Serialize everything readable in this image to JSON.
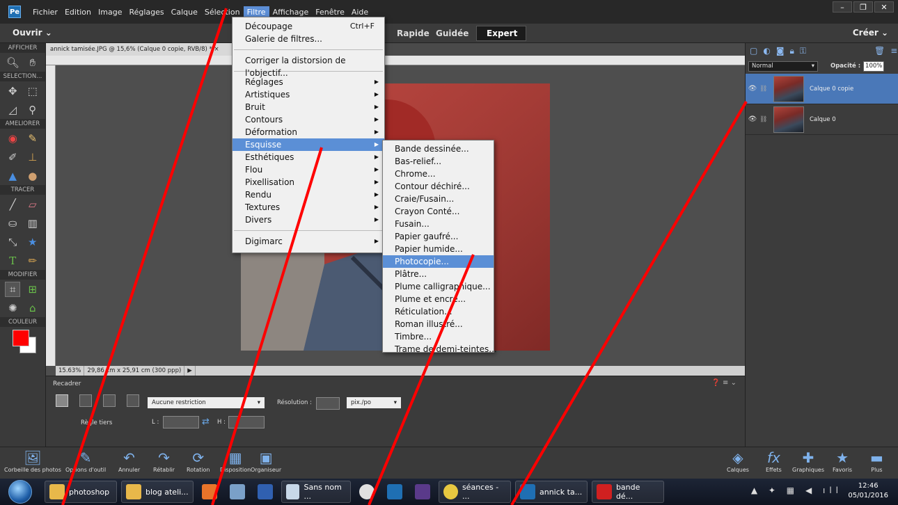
{
  "menubar": {
    "items": [
      "Fichier",
      "Edition",
      "Image",
      "Réglages",
      "Calque",
      "Sélection",
      "Filtre",
      "Affichage",
      "Fenêtre",
      "Aide"
    ],
    "active": "Filtre"
  },
  "modebar": {
    "open_label": "Ouvrir",
    "tabs": [
      "Rapide",
      "Guidée",
      "Expert"
    ],
    "active_tab": "Expert",
    "create_label": "Créer"
  },
  "toolbox": {
    "sections": [
      "AFFICHER",
      "SELECTION...",
      "AMELIORER",
      "TRACER",
      "MODIFIER",
      "COULEUR"
    ],
    "foreground_color": "#ff0000"
  },
  "document": {
    "tab_title": "annick tamisée.JPG @ 15,6% (Calque 0 copie, RVB/8) *",
    "zoom": "15.63%",
    "doc_size": "29,86 cm x 25,91 cm (300 ppp)"
  },
  "filter_menu": {
    "top_items": [
      {
        "label": "Découpage",
        "shortcut": "Ctrl+F"
      },
      {
        "label": "Galerie de filtres..."
      }
    ],
    "correct_item": "Corriger la distorsion de l'objectif...",
    "submenus": [
      "Réglages",
      "Artistiques",
      "Bruit",
      "Contours",
      "Déformation",
      "Esquisse",
      "Esthétiques",
      "Flou",
      "Pixellisation",
      "Rendu",
      "Textures",
      "Divers"
    ],
    "highlighted": "Esquisse",
    "bottom_item": "Digimarc"
  },
  "esquisse_menu": {
    "items": [
      "Bande dessinée...",
      "Bas-relief...",
      "Chrome...",
      "Contour déchiré...",
      "Craie/Fusain...",
      "Crayon Conté...",
      "Fusain...",
      "Papier gaufré...",
      "Papier humide...",
      "Photocopie...",
      "Plâtre...",
      "Plume calligraphique...",
      "Plume et encre...",
      "Réticulation...",
      "Roman illustré...",
      "Timbre...",
      "Trame de demi-teintes..."
    ],
    "highlighted": "Photocopie..."
  },
  "options": {
    "title": "Recadrer",
    "rule_label": "Règle tiers",
    "restriction": "Aucune restriction",
    "resolution_label": "Résolution :",
    "unit": "pix./po",
    "width_label": "L :",
    "height_label": "H :"
  },
  "layers": {
    "blend_mode": "Normal",
    "opacity_label": "Opacité :",
    "opacity": "100%",
    "items": [
      {
        "name": "Calque 0 copie",
        "selected": true
      },
      {
        "name": "Calque 0",
        "selected": false
      }
    ]
  },
  "bottombar": {
    "left_buttons": [
      "Corbeille des photos",
      "Options d'outil",
      "Annuler",
      "Rétablir",
      "Rotation",
      "Disposition",
      "Organiseur"
    ],
    "right_buttons": [
      "Calques",
      "Effets",
      "Graphiques",
      "Favoris",
      "Plus"
    ]
  },
  "taskbar": {
    "tasks": [
      "photoshop",
      "blog ateli...",
      "Sans nom ...",
      "séances - ...",
      "annick ta...",
      "bande dé..."
    ],
    "time": "12:46",
    "date": "05/01/2016"
  }
}
